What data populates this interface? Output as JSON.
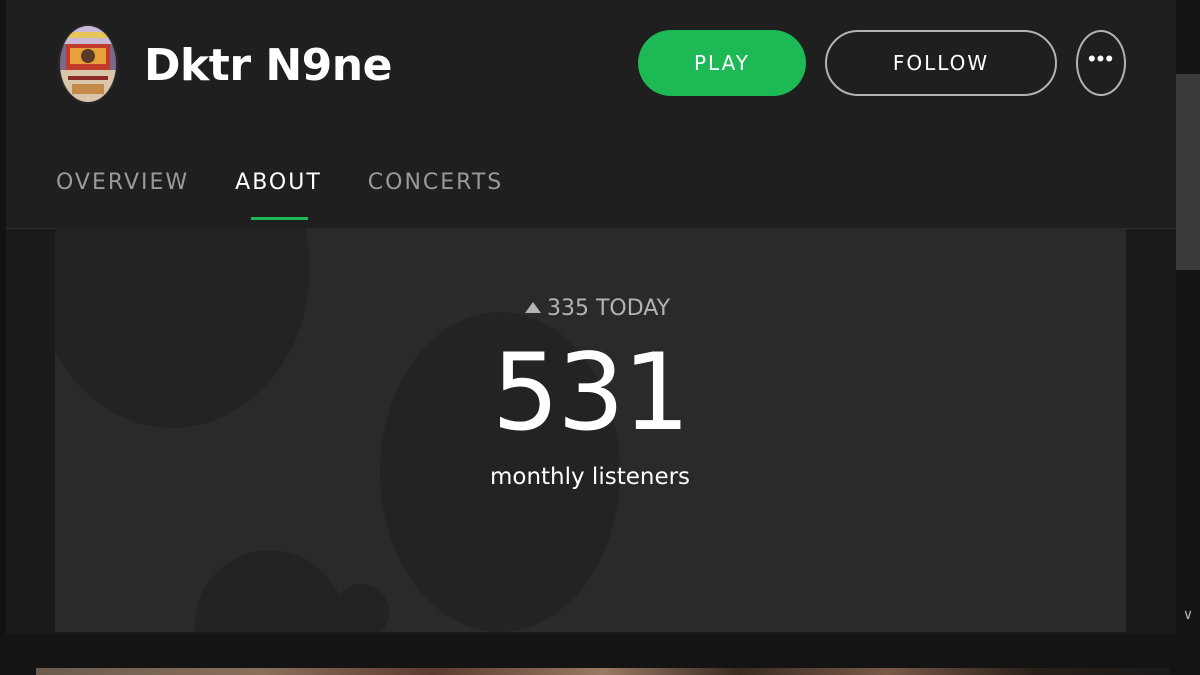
{
  "artist": {
    "name": "Dktr N9ne",
    "avatar_icon": "artist-avatar-image"
  },
  "actions": {
    "play_label": "PLAY",
    "follow_label": "FOLLOW",
    "more_label": "•••",
    "play_color": "#1db954"
  },
  "tabs": [
    {
      "label": "OVERVIEW",
      "active": false
    },
    {
      "label": "ABOUT",
      "active": true
    },
    {
      "label": "CONCERTS",
      "active": false
    }
  ],
  "stats": {
    "today_label": "335 TODAY",
    "trend_icon": "triangle-up-icon",
    "monthly_listeners": "531",
    "monthly_listeners_label": "monthly listeners"
  },
  "scrollbar": {
    "down_icon": "chevron-down-icon",
    "down_glyph": "∨"
  }
}
